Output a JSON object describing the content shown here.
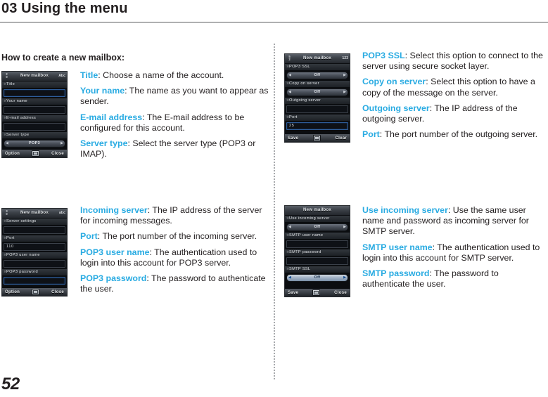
{
  "header": {
    "chapter_title": "03 Using the menu"
  },
  "section": {
    "heading": "How to create a new mailbox:"
  },
  "page": {
    "number": "52"
  },
  "descriptions": {
    "top_left": [
      {
        "term": "Title",
        "text": ": Choose a name of the account."
      },
      {
        "term": "Your name",
        "text": ": The name as you want to appear as sender."
      },
      {
        "term": "E-mail address",
        "text": ": The E-mail address to be configured for this account."
      },
      {
        "term": "Server type",
        "text": ": Select the  server type (POP3 or IMAP)."
      }
    ],
    "top_right": [
      {
        "term": "POP3 SSL",
        "text": ": Select this option to connect to the server using secure socket layer."
      },
      {
        "term": "Copy on server",
        "text": ": Select this option to have a copy of the message on the server."
      },
      {
        "term": "Outgoing server",
        "text": ": The IP address of the outgoing server."
      },
      {
        "term": "Port",
        "text": ": The port number of the outgoing server."
      }
    ],
    "bottom_left": [
      {
        "term": "Incoming server",
        "text": ": The IP address of the server for incoming messages."
      },
      {
        "term": "Port",
        "text": ": The port number of the incoming server."
      },
      {
        "term": "POP3 user name",
        "text": ": The authentication used to login into this account for POP3 server."
      },
      {
        "term": "POP3 password",
        "text": ": The password to authenticate the user."
      }
    ],
    "bottom_right": [
      {
        "term": "Use incoming server",
        "text": ": Use the same user name and password as incoming server for SMTP server."
      },
      {
        "term": "SMTP user name",
        "text": ": The authentication used to login into this account for SMTP server."
      },
      {
        "term": "SMTP password",
        "text": ": The password to authenticate the user."
      }
    ]
  },
  "screens": {
    "screen1": {
      "title": "New mailbox",
      "page_indicator": "2\n0",
      "page_indicator_top": "2",
      "page_indicator_bottom": "0",
      "input_mode": "Abc",
      "fields": [
        {
          "label": "Title",
          "type": "text",
          "value": "",
          "focused": true
        },
        {
          "label": "Your  name",
          "type": "text",
          "value": "",
          "focused": false
        },
        {
          "label": "E-mail  address",
          "type": "text",
          "value": "",
          "focused": false
        },
        {
          "label": "Server  type",
          "type": "spinner",
          "value": "POP3",
          "selected": false
        }
      ],
      "softkey_left": "Option",
      "softkey_right": "Close"
    },
    "screen2": {
      "title": "New mailbox",
      "page_indicator_top": "5",
      "page_indicator_bottom": "2",
      "input_mode": "123",
      "fields": [
        {
          "label": "POP3 SSL",
          "type": "spinner",
          "value": "Off",
          "selected": false
        },
        {
          "label": "Copy  on  server",
          "type": "spinner",
          "value": "Off",
          "selected": false
        },
        {
          "label": "Outgoing  server",
          "type": "text",
          "value": "",
          "focused": false
        },
        {
          "label": "Port",
          "type": "text",
          "value": "25",
          "focused": true
        }
      ],
      "softkey_left": "Save",
      "softkey_right": "Clear"
    },
    "screen3": {
      "title": "New mailbox",
      "page_indicator_top": "3",
      "page_indicator_bottom": "0",
      "input_mode": "abc",
      "fields": [
        {
          "label": "Server  settings",
          "type": "text",
          "value": "",
          "focused": false
        },
        {
          "label": "Port",
          "type": "text",
          "value": "110",
          "focused": false
        },
        {
          "label": "POP3  user  name",
          "type": "text",
          "value": "",
          "focused": false
        },
        {
          "label": "POP3  password",
          "type": "text",
          "value": "",
          "focused": true
        }
      ],
      "softkey_left": "Option",
      "softkey_right": "Close"
    },
    "screen4": {
      "title": "New mailbox",
      "page_indicator_top": "",
      "page_indicator_bottom": "",
      "input_mode": "",
      "fields": [
        {
          "label": "Use  incoming  server",
          "type": "spinner",
          "value": "Off",
          "selected": false
        },
        {
          "label": "SMTP  user  name",
          "type": "text",
          "value": "",
          "focused": false
        },
        {
          "label": "SMTP  password",
          "type": "text",
          "value": "",
          "focused": false
        },
        {
          "label": "SMTP  SSL",
          "type": "spinner",
          "value": "Off",
          "selected": true
        }
      ],
      "softkey_left": "Save",
      "softkey_right": "Close"
    }
  }
}
